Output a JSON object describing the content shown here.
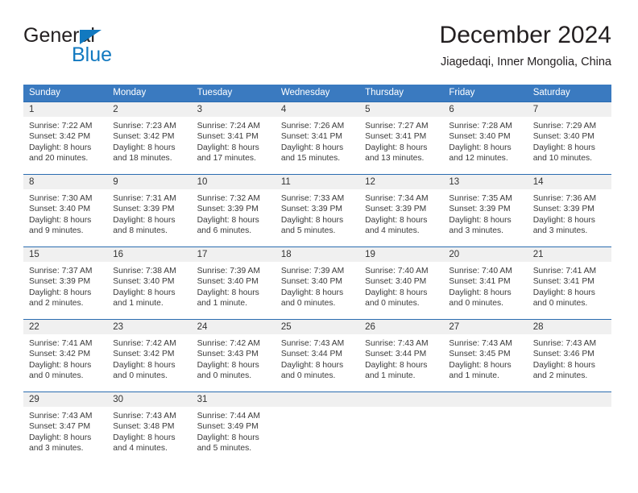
{
  "brand": {
    "name_dark": "General",
    "name_blue": "Blue",
    "logo_icon": "triangle-icon",
    "accent_color": "#1279c0"
  },
  "header": {
    "title": "December 2024",
    "subtitle": "Jiagedaqi, Inner Mongolia, China"
  },
  "calendar": {
    "header_bg": "#3a7ac0",
    "header_text_color": "#ffffff",
    "cell_band_bg": "#f0f0f0",
    "cell_border_color": "#2b6cb0",
    "weekday_headers": [
      "Sunday",
      "Monday",
      "Tuesday",
      "Wednesday",
      "Thursday",
      "Friday",
      "Saturday"
    ],
    "weeks": [
      [
        null,
        null,
        null,
        null,
        null,
        null,
        null
      ],
      [
        null,
        null,
        null,
        null,
        null,
        null,
        null
      ]
    ],
    "days": [
      {
        "date": "1",
        "weekday": "Sunday",
        "sunrise": "Sunrise: 7:22 AM",
        "sunset": "Sunset: 3:42 PM",
        "daylight_line1": "Daylight: 8 hours",
        "daylight_line2": "and 20 minutes."
      },
      {
        "date": "2",
        "weekday": "Monday",
        "sunrise": "Sunrise: 7:23 AM",
        "sunset": "Sunset: 3:42 PM",
        "daylight_line1": "Daylight: 8 hours",
        "daylight_line2": "and 18 minutes."
      },
      {
        "date": "3",
        "weekday": "Tuesday",
        "sunrise": "Sunrise: 7:24 AM",
        "sunset": "Sunset: 3:41 PM",
        "daylight_line1": "Daylight: 8 hours",
        "daylight_line2": "and 17 minutes."
      },
      {
        "date": "4",
        "weekday": "Wednesday",
        "sunrise": "Sunrise: 7:26 AM",
        "sunset": "Sunset: 3:41 PM",
        "daylight_line1": "Daylight: 8 hours",
        "daylight_line2": "and 15 minutes."
      },
      {
        "date": "5",
        "weekday": "Thursday",
        "sunrise": "Sunrise: 7:27 AM",
        "sunset": "Sunset: 3:41 PM",
        "daylight_line1": "Daylight: 8 hours",
        "daylight_line2": "and 13 minutes."
      },
      {
        "date": "6",
        "weekday": "Friday",
        "sunrise": "Sunrise: 7:28 AM",
        "sunset": "Sunset: 3:40 PM",
        "daylight_line1": "Daylight: 8 hours",
        "daylight_line2": "and 12 minutes."
      },
      {
        "date": "7",
        "weekday": "Saturday",
        "sunrise": "Sunrise: 7:29 AM",
        "sunset": "Sunset: 3:40 PM",
        "daylight_line1": "Daylight: 8 hours",
        "daylight_line2": "and 10 minutes."
      },
      {
        "date": "8",
        "weekday": "Sunday",
        "sunrise": "Sunrise: 7:30 AM",
        "sunset": "Sunset: 3:40 PM",
        "daylight_line1": "Daylight: 8 hours",
        "daylight_line2": "and 9 minutes."
      },
      {
        "date": "9",
        "weekday": "Monday",
        "sunrise": "Sunrise: 7:31 AM",
        "sunset": "Sunset: 3:39 PM",
        "daylight_line1": "Daylight: 8 hours",
        "daylight_line2": "and 8 minutes."
      },
      {
        "date": "10",
        "weekday": "Tuesday",
        "sunrise": "Sunrise: 7:32 AM",
        "sunset": "Sunset: 3:39 PM",
        "daylight_line1": "Daylight: 8 hours",
        "daylight_line2": "and 6 minutes."
      },
      {
        "date": "11",
        "weekday": "Wednesday",
        "sunrise": "Sunrise: 7:33 AM",
        "sunset": "Sunset: 3:39 PM",
        "daylight_line1": "Daylight: 8 hours",
        "daylight_line2": "and 5 minutes."
      },
      {
        "date": "12",
        "weekday": "Thursday",
        "sunrise": "Sunrise: 7:34 AM",
        "sunset": "Sunset: 3:39 PM",
        "daylight_line1": "Daylight: 8 hours",
        "daylight_line2": "and 4 minutes."
      },
      {
        "date": "13",
        "weekday": "Friday",
        "sunrise": "Sunrise: 7:35 AM",
        "sunset": "Sunset: 3:39 PM",
        "daylight_line1": "Daylight: 8 hours",
        "daylight_line2": "and 3 minutes."
      },
      {
        "date": "14",
        "weekday": "Saturday",
        "sunrise": "Sunrise: 7:36 AM",
        "sunset": "Sunset: 3:39 PM",
        "daylight_line1": "Daylight: 8 hours",
        "daylight_line2": "and 3 minutes."
      },
      {
        "date": "15",
        "weekday": "Sunday",
        "sunrise": "Sunrise: 7:37 AM",
        "sunset": "Sunset: 3:39 PM",
        "daylight_line1": "Daylight: 8 hours",
        "daylight_line2": "and 2 minutes."
      },
      {
        "date": "16",
        "weekday": "Monday",
        "sunrise": "Sunrise: 7:38 AM",
        "sunset": "Sunset: 3:40 PM",
        "daylight_line1": "Daylight: 8 hours",
        "daylight_line2": "and 1 minute."
      },
      {
        "date": "17",
        "weekday": "Tuesday",
        "sunrise": "Sunrise: 7:39 AM",
        "sunset": "Sunset: 3:40 PM",
        "daylight_line1": "Daylight: 8 hours",
        "daylight_line2": "and 1 minute."
      },
      {
        "date": "18",
        "weekday": "Wednesday",
        "sunrise": "Sunrise: 7:39 AM",
        "sunset": "Sunset: 3:40 PM",
        "daylight_line1": "Daylight: 8 hours",
        "daylight_line2": "and 0 minutes."
      },
      {
        "date": "19",
        "weekday": "Thursday",
        "sunrise": "Sunrise: 7:40 AM",
        "sunset": "Sunset: 3:40 PM",
        "daylight_line1": "Daylight: 8 hours",
        "daylight_line2": "and 0 minutes."
      },
      {
        "date": "20",
        "weekday": "Friday",
        "sunrise": "Sunrise: 7:40 AM",
        "sunset": "Sunset: 3:41 PM",
        "daylight_line1": "Daylight: 8 hours",
        "daylight_line2": "and 0 minutes."
      },
      {
        "date": "21",
        "weekday": "Saturday",
        "sunrise": "Sunrise: 7:41 AM",
        "sunset": "Sunset: 3:41 PM",
        "daylight_line1": "Daylight: 8 hours",
        "daylight_line2": "and 0 minutes."
      },
      {
        "date": "22",
        "weekday": "Sunday",
        "sunrise": "Sunrise: 7:41 AM",
        "sunset": "Sunset: 3:42 PM",
        "daylight_line1": "Daylight: 8 hours",
        "daylight_line2": "and 0 minutes."
      },
      {
        "date": "23",
        "weekday": "Monday",
        "sunrise": "Sunrise: 7:42 AM",
        "sunset": "Sunset: 3:42 PM",
        "daylight_line1": "Daylight: 8 hours",
        "daylight_line2": "and 0 minutes."
      },
      {
        "date": "24",
        "weekday": "Tuesday",
        "sunrise": "Sunrise: 7:42 AM",
        "sunset": "Sunset: 3:43 PM",
        "daylight_line1": "Daylight: 8 hours",
        "daylight_line2": "and 0 minutes."
      },
      {
        "date": "25",
        "weekday": "Wednesday",
        "sunrise": "Sunrise: 7:43 AM",
        "sunset": "Sunset: 3:44 PM",
        "daylight_line1": "Daylight: 8 hours",
        "daylight_line2": "and 0 minutes."
      },
      {
        "date": "26",
        "weekday": "Thursday",
        "sunrise": "Sunrise: 7:43 AM",
        "sunset": "Sunset: 3:44 PM",
        "daylight_line1": "Daylight: 8 hours",
        "daylight_line2": "and 1 minute."
      },
      {
        "date": "27",
        "weekday": "Friday",
        "sunrise": "Sunrise: 7:43 AM",
        "sunset": "Sunset: 3:45 PM",
        "daylight_line1": "Daylight: 8 hours",
        "daylight_line2": "and 1 minute."
      },
      {
        "date": "28",
        "weekday": "Saturday",
        "sunrise": "Sunrise: 7:43 AM",
        "sunset": "Sunset: 3:46 PM",
        "daylight_line1": "Daylight: 8 hours",
        "daylight_line2": "and 2 minutes."
      },
      {
        "date": "29",
        "weekday": "Sunday",
        "sunrise": "Sunrise: 7:43 AM",
        "sunset": "Sunset: 3:47 PM",
        "daylight_line1": "Daylight: 8 hours",
        "daylight_line2": "and 3 minutes."
      },
      {
        "date": "30",
        "weekday": "Monday",
        "sunrise": "Sunrise: 7:43 AM",
        "sunset": "Sunset: 3:48 PM",
        "daylight_line1": "Daylight: 8 hours",
        "daylight_line2": "and 4 minutes."
      },
      {
        "date": "31",
        "weekday": "Tuesday",
        "sunrise": "Sunrise: 7:44 AM",
        "sunset": "Sunset: 3:49 PM",
        "daylight_line1": "Daylight: 8 hours",
        "daylight_line2": "and 5 minutes."
      }
    ],
    "leading_blanks": 0,
    "trailing_blanks": 4
  }
}
